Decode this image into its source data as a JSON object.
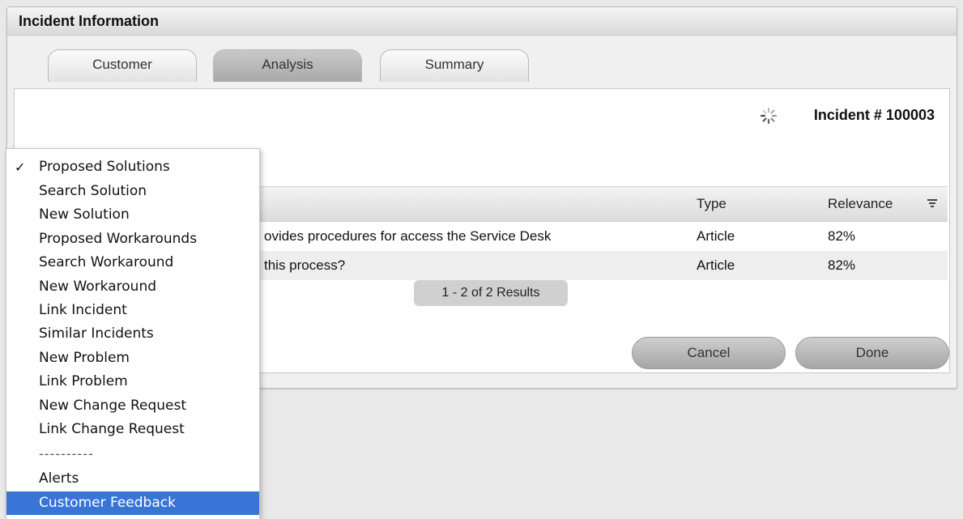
{
  "panel": {
    "title": "Incident Information"
  },
  "tabs": [
    {
      "label": "Customer",
      "active": false
    },
    {
      "label": "Analysis",
      "active": true
    },
    {
      "label": "Summary",
      "active": false
    }
  ],
  "incident": {
    "number_label": "Incident # 100003"
  },
  "table": {
    "headers": {
      "type": "Type",
      "relevance": "Relevance"
    },
    "rows": [
      {
        "title": "ovides procedures for access the Service Desk",
        "type": "Article",
        "relevance": "82%"
      },
      {
        "title": "this process?",
        "type": "Article",
        "relevance": "82%"
      }
    ],
    "results_label": "1 - 2 of 2 Results"
  },
  "buttons": {
    "cancel": "Cancel",
    "done": "Done"
  },
  "menu": {
    "check_glyph": "✓",
    "items": [
      "Proposed Solutions",
      "Search Solution",
      "New Solution",
      "Proposed Workarounds",
      "Search Workaround",
      "New Workaround",
      "Link Incident",
      "Similar Incidents",
      "New Problem",
      "Link Problem",
      "New Change Request",
      "Link Change Request"
    ],
    "separator": "----------",
    "alerts": "Alerts",
    "customer_feedback": "Customer Feedback",
    "checked_item": "Proposed Solutions",
    "selected_item": "Customer Feedback"
  },
  "icons": {
    "spinner": "loading-spinner-icon",
    "filter": "filter-icon",
    "check": "checkmark-icon"
  },
  "colors": {
    "menu_selected": "#3875d7",
    "tab_active": "#b5b5b5"
  }
}
